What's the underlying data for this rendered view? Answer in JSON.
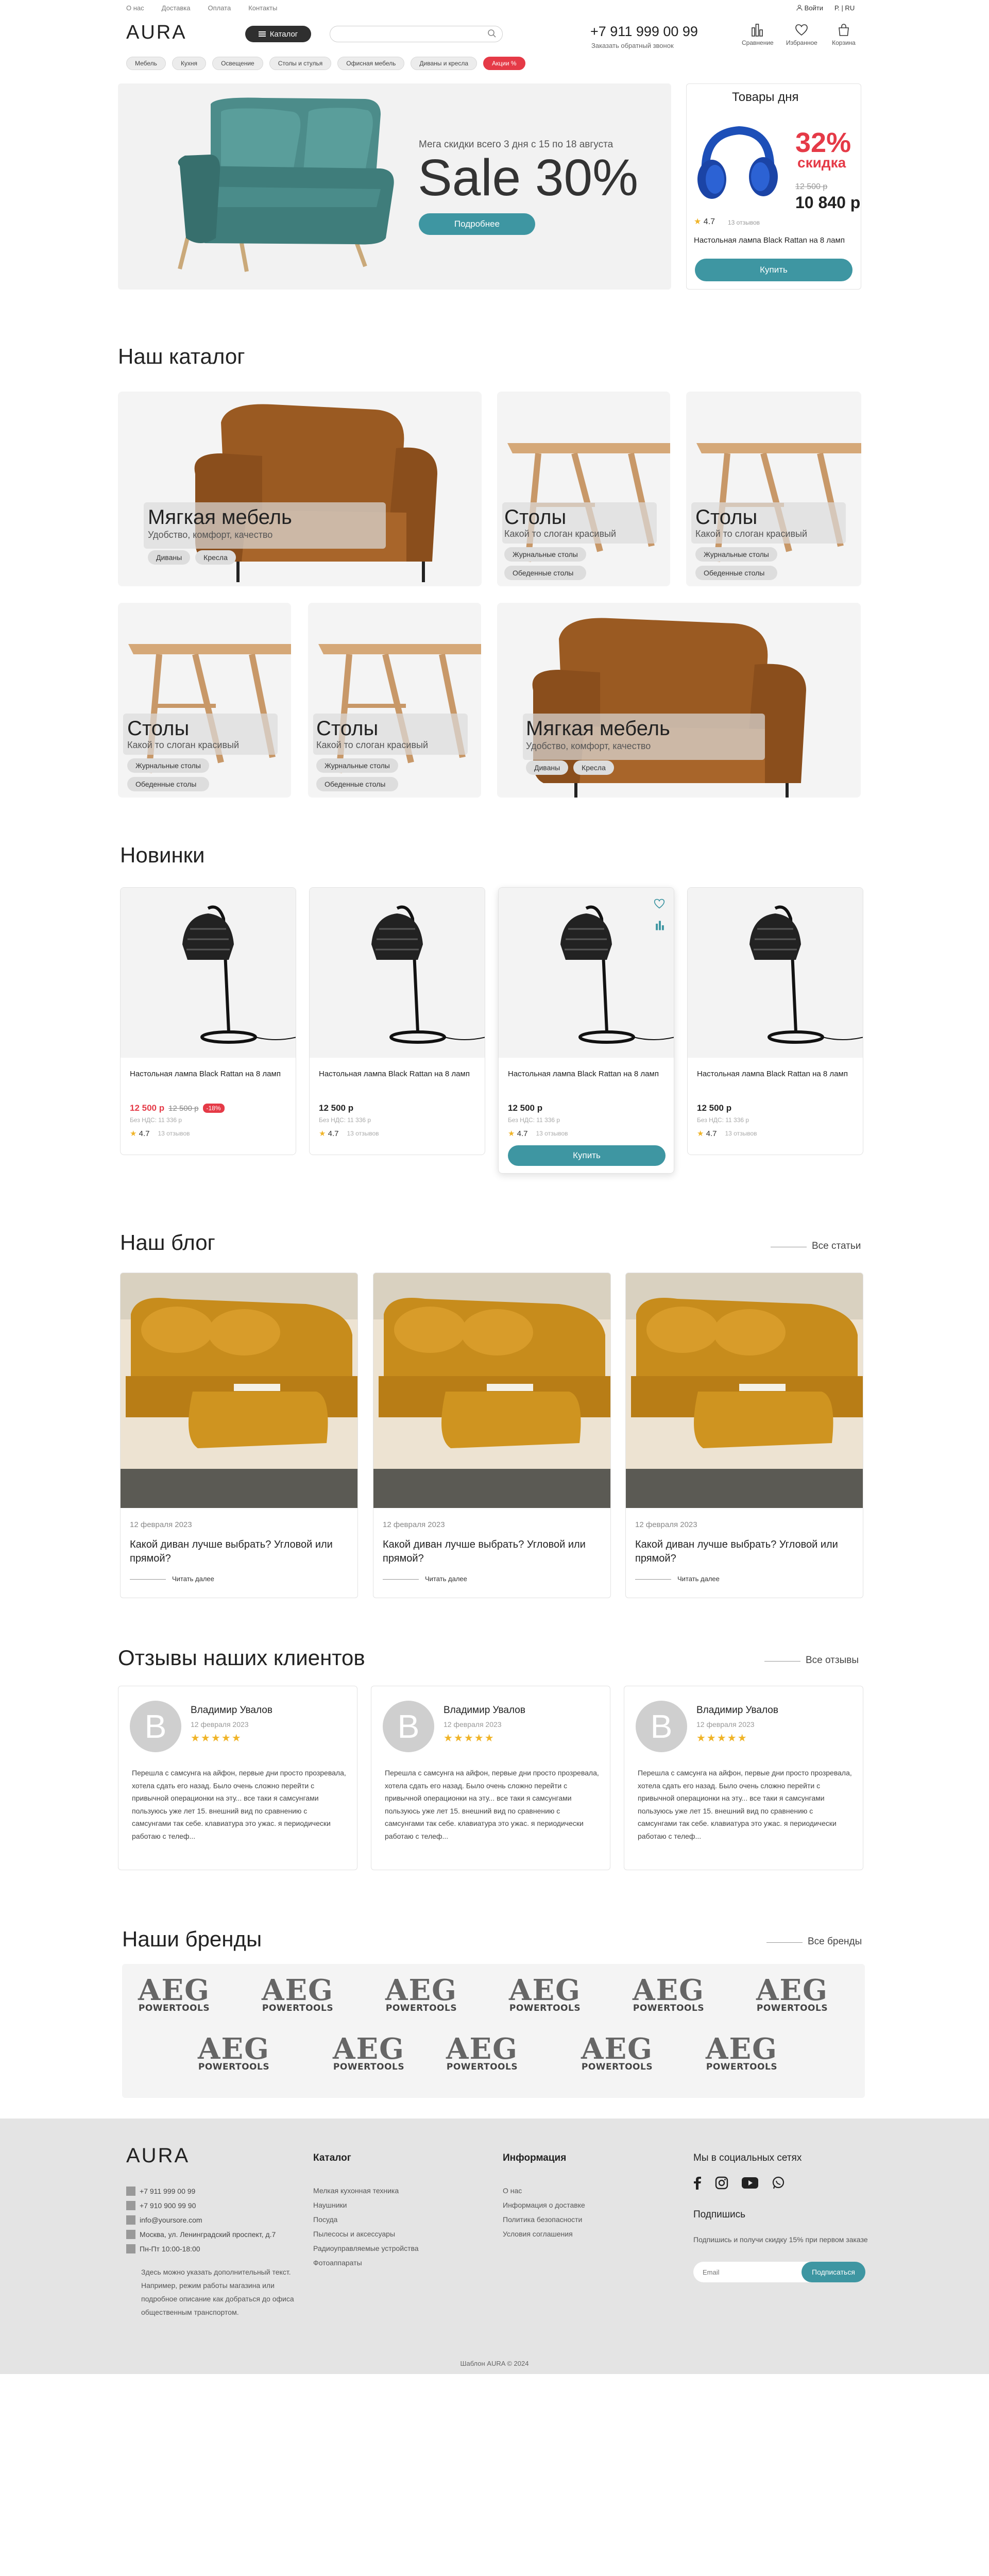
{
  "header": {
    "top_links": [
      "О нас",
      "Доставка",
      "Оплата",
      "Контакты"
    ],
    "login": "Войти",
    "lang": "Р. | RU",
    "logo": "AURA",
    "catalog_btn": "Каталог",
    "search_placeholder": "",
    "phone": "+7 911 999 00 99",
    "callback": "Заказать обратный звонок",
    "icons": [
      {
        "label": "Сравнение",
        "icon": "compare-icon"
      },
      {
        "label": "Избранное",
        "icon": "heart-icon"
      },
      {
        "label": "Корзина",
        "icon": "cart-icon"
      }
    ],
    "chips": [
      "Мебель",
      "Кухня",
      "Освещение",
      "Столы и стулья",
      "Офисная мебель",
      "Диваны и кресла",
      "Акции %"
    ]
  },
  "hero": {
    "subtitle": "Мега скидки всего 3 дня с 15 по 18 августа",
    "title": "Sale 30%",
    "button": "Подробнее"
  },
  "deal": {
    "title": "Товары дня",
    "percent": "32%",
    "percent_label": "скидка",
    "old_price": "12 500 р",
    "new_price": "10 840 р",
    "rating": "4.7",
    "reviews": "13 отзывов",
    "name": "Настольная лампа Black Rattan на 8 ламп",
    "button": "Купить"
  },
  "catalog": {
    "title": "Наш каталог",
    "cards": [
      {
        "title": "Мягкая мебель",
        "subtitle": "Удобство, комфорт, качество",
        "tags": [
          "Диваны",
          "Кресла"
        ]
      },
      {
        "title": "Столы",
        "subtitle": "Какой то слоган красивый",
        "tags": [
          "Журнальные столы",
          "Обеденные столы"
        ]
      },
      {
        "title": "Столы",
        "subtitle": "Какой то слоган красивый",
        "tags": [
          "Журнальные столы",
          "Обеденные столы"
        ]
      },
      {
        "title": "Столы",
        "subtitle": "Какой то слоган красивый",
        "tags": [
          "Журнальные столы",
          "Обеденные столы"
        ]
      },
      {
        "title": "Столы",
        "subtitle": "Какой то слоган красивый",
        "tags": [
          "Журнальные столы",
          "Обеденные столы"
        ]
      },
      {
        "title": "Мягкая мебель",
        "subtitle": "Удобство, комфорт, качество",
        "tags": [
          "Диваны",
          "Кресла"
        ]
      }
    ]
  },
  "new_items": {
    "title": "Новинки",
    "products": [
      {
        "name": "Настольная лампа Black Rattan на 8 ламп",
        "price": "12 500 р",
        "old_price": "12 500 р",
        "badge": "-18%",
        "vat": "Без НДС: 11 336 р",
        "rating": "4.7",
        "reviews": "13 отзывов",
        "sale": true
      },
      {
        "name": "Настольная лампа Black Rattan на 8 ламп",
        "price": "12 500 р",
        "old_price": "",
        "badge": "",
        "vat": "Без НДС: 11 336 р",
        "rating": "4.7",
        "reviews": "13 отзывов",
        "sale": false
      },
      {
        "name": "Настольная лампа Black Rattan на 8 ламп",
        "price": "12 500 р",
        "old_price": "",
        "badge": "",
        "vat": "Без НДС: 11 336 р",
        "rating": "4.7",
        "reviews": "13 отзывов",
        "sale": false,
        "buy": "Купить"
      },
      {
        "name": "Настольная лампа Black Rattan на 8 ламп",
        "price": "12 500 р",
        "old_price": "",
        "badge": "",
        "vat": "Без НДС: 11 336 р",
        "rating": "4.7",
        "reviews": "13 отзывов",
        "sale": false
      }
    ]
  },
  "blog": {
    "title": "Наш блог",
    "all_link": "Все статьи",
    "posts": [
      {
        "date": "12 февраля 2023",
        "title": "Какой диван лучше выбрать? Угловой или прямой?",
        "more": "Читать далее"
      },
      {
        "date": "12 февраля 2023",
        "title": "Какой диван лучше выбрать? Угловой или прямой?",
        "more": "Читать далее"
      },
      {
        "date": "12 февраля 2023",
        "title": "Какой диван лучше выбрать? Угловой или прямой?",
        "more": "Читать далее"
      }
    ]
  },
  "reviews": {
    "title": "Отзывы наших клиентов",
    "all_link": "Все отзывы",
    "items": [
      {
        "initial": "В",
        "name": "Владимир Увалов",
        "date": "12 февраля 2023",
        "stars": "★★★★★",
        "text": "Перешла с самсунга на айфон, первые дни просто прозревала, хотела сдать его назад. Было очень сложно перейти с привычной операционки на эту... все таки я самсунгами пользуюсь уже лет 15. внешний вид по сравнению с самсунгами так себе. клавиатура это ужас. я периодически работаю с телеф..."
      },
      {
        "initial": "В",
        "name": "Владимир Увалов",
        "date": "12 февраля 2023",
        "stars": "★★★★★",
        "text": "Перешла с самсунга на айфон, первые дни просто прозревала, хотела сдать его назад. Было очень сложно перейти с привычной операционки на эту... все таки я самсунгами пользуюсь уже лет 15. внешний вид по сравнению с самсунгами так себе. клавиатура это ужас. я периодически работаю с телеф..."
      },
      {
        "initial": "В",
        "name": "Владимир Увалов",
        "date": "12 февраля 2023",
        "stars": "★★★★★",
        "text": "Перешла с самсунга на айфон, первые дни просто прозревала, хотела сдать его назад. Было очень сложно перейти с привычной операционки на эту... все таки я самсунгами пользуюсь уже лет 15. внешний вид по сравнению с самсунгами так себе. клавиатура это ужас. я периодически работаю с телеф..."
      }
    ]
  },
  "brands": {
    "title": "Наши бренды",
    "all_link": "Все бренды",
    "brand_top": "AEG",
    "brand_bottom": "POWERTOOLS"
  },
  "footer": {
    "logo": "AURA",
    "contacts": [
      "+7 911 999 00 99",
      "+7 910 900 99 90",
      "info@yoursore.com",
      "Москва, ул. Ленинградский проспект, д.7",
      "Пн-Пт 10:00-18:00"
    ],
    "note": "Здесь можно указать дополнительный текст. Например, режим работы магазина или подробное описание как добраться до офиса общественным транспортом.",
    "catalog_title": "Каталог",
    "catalog_links": [
      "Мелкая кухонная техника",
      "Наушники",
      "Посуда",
      "Пылесосы и аксессуары",
      "Радиоуправляемые устройства",
      "Фотоаппараты"
    ],
    "info_title": "Информация",
    "info_links": [
      "О нас",
      "Информация о доставке",
      "Политика безопасности",
      "Условия соглашения"
    ],
    "social_title": "Мы в социальных сетях",
    "subscribe_title": "Подпишись",
    "subscribe_text": "Подпишись и получи скидку 15% при первом заказе",
    "email_placeholder": "Email",
    "subscribe_btn": "Подписаться",
    "copyright": "Шаблон AURA © 2024"
  },
  "colors": {
    "accent": "#3e96a2",
    "sale": "#e53a47",
    "star": "#f0b428"
  }
}
